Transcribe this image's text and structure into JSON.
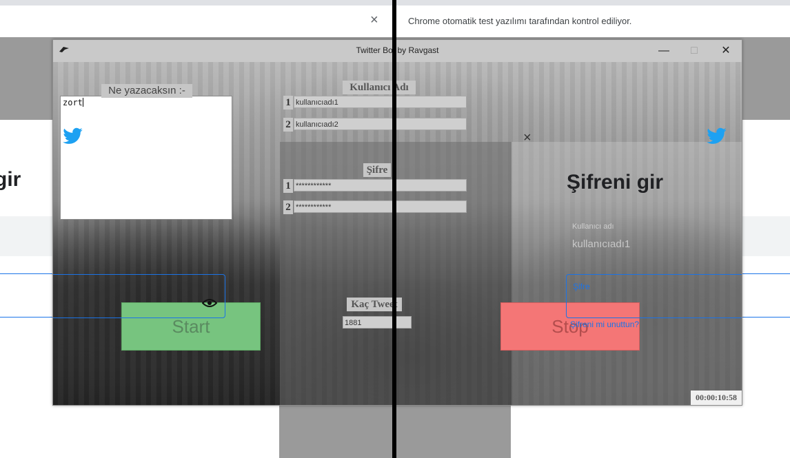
{
  "browser": {
    "info_bar_text": "Chrome otomatik test yazılımı tarafından kontrol ediliyor.",
    "info_bar_close": "×",
    "left_heading_fragment": "gir"
  },
  "window": {
    "title": "Twitter Bot by Ravgast",
    "minimize": "—",
    "maximize": "□",
    "close": "✕"
  },
  "app": {
    "compose_label": "Ne yazacaksın :-",
    "compose_text": "zort",
    "username_header": "Kullanıcı Adı",
    "usernames": [
      {
        "num": "1",
        "value": "kullanıcıadı1"
      },
      {
        "num": "2",
        "value": "kullanıcıadı2"
      }
    ],
    "password_header": "Şifre",
    "passwords": [
      {
        "num": "1",
        "value": "************"
      },
      {
        "num": "2",
        "value": "************"
      }
    ],
    "tweet_count_header": "Kaç Tweet",
    "tweet_count_value": "1881",
    "start_label": "Start",
    "stop_label": "Stop",
    "timer": "00:00:10:58"
  },
  "overlay_login": {
    "close": "×",
    "title": "Şifreni gir",
    "username_label": "Kullanıcı adı",
    "username_value": "kullanıcıadı1",
    "password_label": "Şifre",
    "forgot_link": "Şifreni mi unuttun?"
  },
  "colors": {
    "start": "#77c47f",
    "stop": "#f47676",
    "twitter_blue": "#1da1f2",
    "link_blue": "#1a73e8"
  }
}
